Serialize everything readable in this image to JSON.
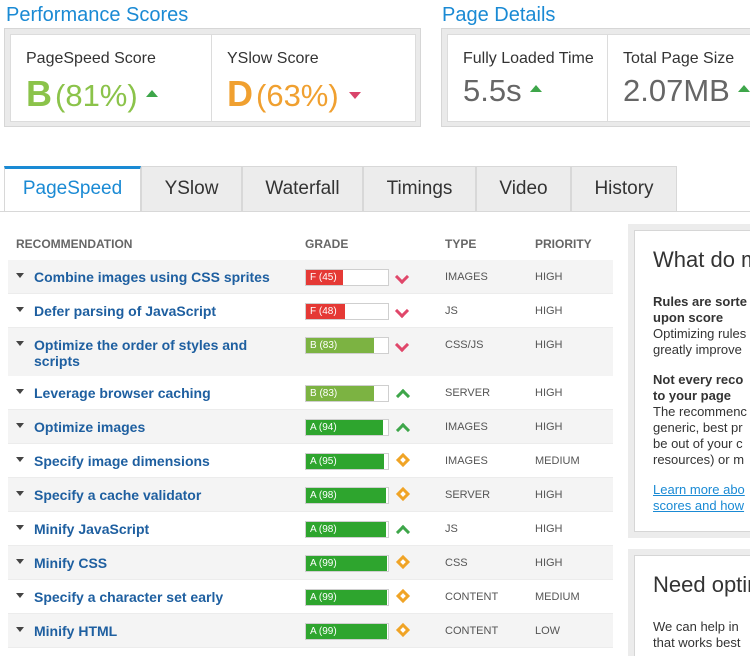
{
  "performance": {
    "title": "Performance Scores",
    "pagespeed": {
      "label": "PageSpeed Score",
      "grade": "B",
      "percent": "(81%)",
      "grade_color": "#8bc34a"
    },
    "yslow": {
      "label": "YSlow Score",
      "grade": "D",
      "percent": "(63%)",
      "grade_color": "#f0a030"
    }
  },
  "details": {
    "title": "Page Details",
    "load_time": {
      "label": "Fully Loaded Time",
      "value": "5.5s"
    },
    "page_size": {
      "label": "Total Page Size",
      "value": "2.07MB"
    }
  },
  "tabs": [
    "PageSpeed",
    "YSlow",
    "Waterfall",
    "Timings",
    "Video",
    "History"
  ],
  "columns": {
    "recommendation": "RECOMMENDATION",
    "grade": "GRADE",
    "type": "TYPE",
    "priority": "PRIORITY"
  },
  "rows": [
    {
      "name": "Combine images using CSS sprites",
      "grade": "F (45)",
      "score": 45,
      "color": "#e53935",
      "trend": "down",
      "type": "IMAGES",
      "priority": "HIGH"
    },
    {
      "name": "Defer parsing of JavaScript",
      "grade": "F (48)",
      "score": 48,
      "color": "#e53935",
      "trend": "down",
      "type": "JS",
      "priority": "HIGH"
    },
    {
      "name": "Optimize the order of styles and scripts",
      "grade": "B (83)",
      "score": 83,
      "color": "#7cb342",
      "trend": "down",
      "type": "CSS/JS",
      "priority": "HIGH"
    },
    {
      "name": "Leverage browser caching",
      "grade": "B (83)",
      "score": 83,
      "color": "#7cb342",
      "trend": "up",
      "type": "SERVER",
      "priority": "HIGH"
    },
    {
      "name": "Optimize images",
      "grade": "A (94)",
      "score": 94,
      "color": "#2ea52e",
      "trend": "up",
      "type": "IMAGES",
      "priority": "HIGH"
    },
    {
      "name": "Specify image dimensions",
      "grade": "A (95)",
      "score": 95,
      "color": "#2ea52e",
      "trend": "same",
      "type": "IMAGES",
      "priority": "MEDIUM"
    },
    {
      "name": "Specify a cache validator",
      "grade": "A (98)",
      "score": 98,
      "color": "#2ea52e",
      "trend": "same",
      "type": "SERVER",
      "priority": "HIGH"
    },
    {
      "name": "Minify JavaScript",
      "grade": "A (98)",
      "score": 98,
      "color": "#2ea52e",
      "trend": "up",
      "type": "JS",
      "priority": "HIGH"
    },
    {
      "name": "Minify CSS",
      "grade": "A (99)",
      "score": 99,
      "color": "#2ea52e",
      "trend": "same",
      "type": "CSS",
      "priority": "HIGH"
    },
    {
      "name": "Specify a character set early",
      "grade": "A (99)",
      "score": 99,
      "color": "#2ea52e",
      "trend": "same",
      "type": "CONTENT",
      "priority": "MEDIUM"
    },
    {
      "name": "Minify HTML",
      "grade": "A (99)",
      "score": 99,
      "color": "#2ea52e",
      "trend": "same",
      "type": "CONTENT",
      "priority": "LOW"
    }
  ],
  "sidebar": {
    "box1": {
      "title": "What do m",
      "p1_bold_1": "Rules are sorte",
      "p1_bold_2": "upon score",
      "p1_line_1": "Optimizing rules",
      "p1_line_2": "greatly improve",
      "p2_bold_1": "Not every reco",
      "p2_bold_2": "to your page",
      "p2_line_1": "The recommenc",
      "p2_line_2": "generic, best pr",
      "p2_line_3": "be out of your c",
      "p2_line_4": "resources) or m",
      "link_1": "Learn more abo",
      "link_2": "scores and how"
    },
    "box2": {
      "title": "Need optir",
      "line_1": "We can help in",
      "line_2": "that works best"
    }
  }
}
